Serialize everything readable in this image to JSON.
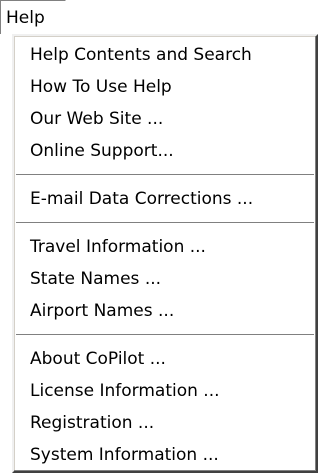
{
  "menubar": {
    "help_label": "Help"
  },
  "menu": {
    "group1": [
      {
        "label": "Help Contents and Search"
      },
      {
        "label": "How To Use Help"
      },
      {
        "label": "Our Web Site ..."
      },
      {
        "label": "Online Support..."
      }
    ],
    "group2": [
      {
        "label": "E-mail Data Corrections ..."
      }
    ],
    "group3": [
      {
        "label": "Travel Information ..."
      },
      {
        "label": "State Names ..."
      },
      {
        "label": "Airport Names ..."
      }
    ],
    "group4": [
      {
        "label": "About CoPilot ..."
      },
      {
        "label": "License Information ..."
      },
      {
        "label": "Registration ..."
      },
      {
        "label": "System Information ..."
      }
    ]
  }
}
